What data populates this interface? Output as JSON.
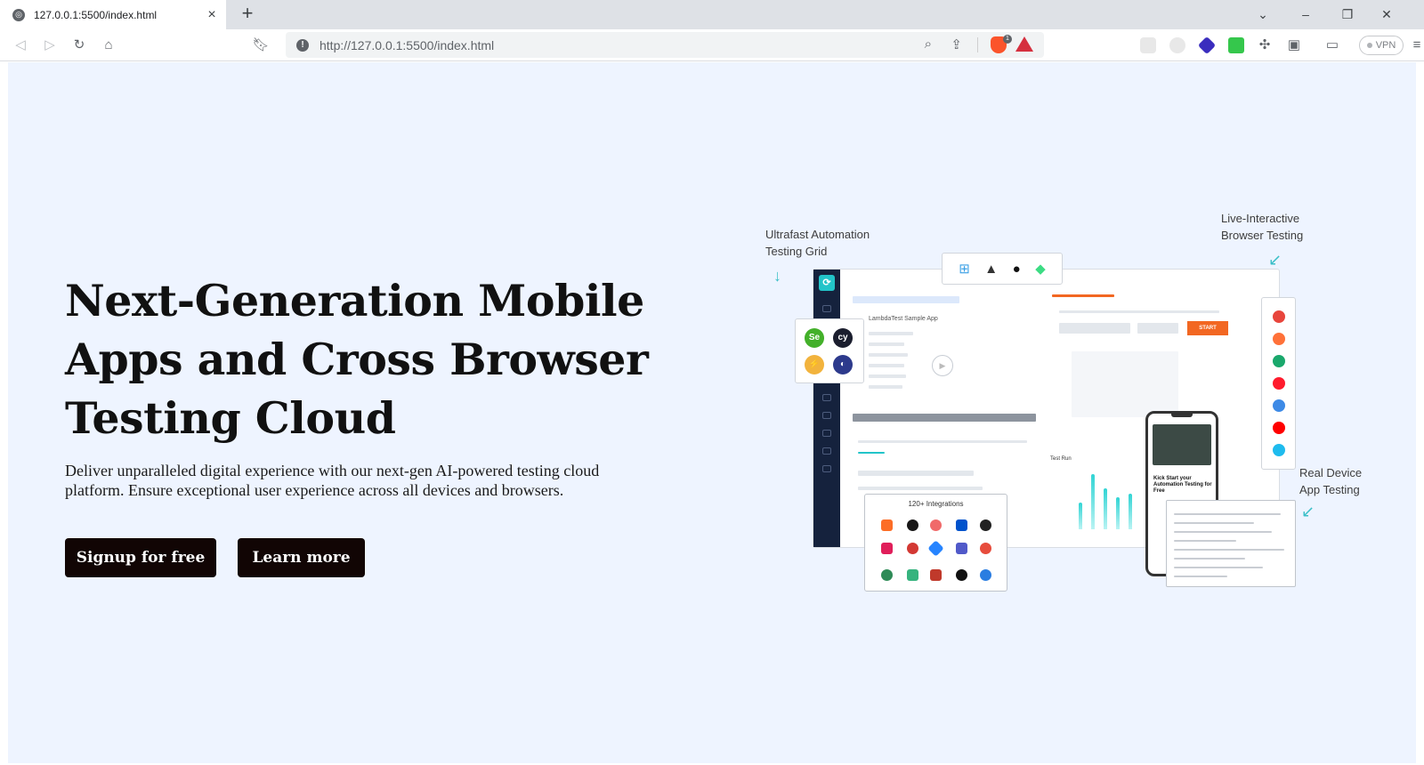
{
  "browser": {
    "tab": {
      "title": "127.0.0.1:5500/index.html"
    },
    "address": {
      "url": "http://127.0.0.1:5500/index.html"
    },
    "vpn_label": "VPN",
    "accent_colors": {
      "brave": "#fb542b",
      "rewards": "#d5303f"
    }
  },
  "page": {
    "hero": {
      "title": "Next-Generation Mobile Apps and Cross Browser Testing Cloud",
      "description": "Deliver unparalleled digital experience with our next-gen AI-powered testing cloud platform. Ensure exceptional user experience across all devices and browsers.",
      "signup_label": "Signup for free",
      "learn_label": "Learn more"
    },
    "illustration": {
      "annotation_automation": "Ultrafast Automation Testing Grid",
      "annotation_live": "Live-Interactive Browser Testing",
      "annotation_real_device": "Real Device App Testing",
      "integrations_title": "120+ Integrations",
      "app_title": "LambdaTest Sample App",
      "start_label": "START",
      "test_run_label": "Test Run",
      "phone_text": "Kick Start your Automation Testing for Free",
      "framework_labels": {
        "selenium": "Se",
        "cypress": "cy"
      },
      "colors": {
        "teal": "#22c4c9",
        "sidebar": "#15223d",
        "start": "#f26722"
      }
    }
  }
}
